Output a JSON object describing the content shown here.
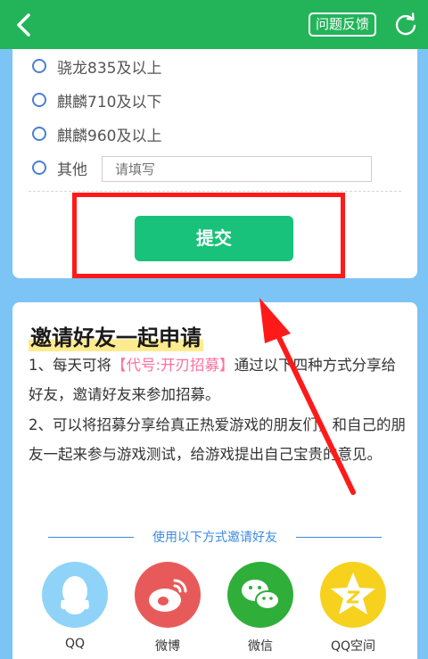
{
  "header": {
    "feedback_label": "问题反馈",
    "colors": {
      "bar": "#23b45a"
    }
  },
  "form": {
    "options": [
      {
        "label": "骁龙835及以上"
      },
      {
        "label": "麒麟710及以下"
      },
      {
        "label": "麒麟960及以上"
      },
      {
        "label": "其他"
      }
    ],
    "other_placeholder": "请填写",
    "submit_label": "提交"
  },
  "invite": {
    "title": "邀请好友一起申请",
    "p1_before": "1、每天可将",
    "p1_highlight": "【代号:开刃招募】",
    "p1_after": "通过以下四种方式分享给好友，邀请好友来参加招募。",
    "p2": "2、可以将招募分享给真正热爱游戏的朋友们，和自己的朋友一起来参与游戏测试，给游戏提出自己宝贵的意见。",
    "share_title": "使用以下方式邀请好友",
    "share": [
      {
        "label": "QQ",
        "icon": "qq-icon",
        "color": "#8fd3f8"
      },
      {
        "label": "微博",
        "icon": "weibo-icon",
        "color": "#e85a5a"
      },
      {
        "label": "微信",
        "icon": "wechat-icon",
        "color": "#2fae3a"
      },
      {
        "label": "QQ空间",
        "icon": "qzone-icon",
        "color": "#f6d11e"
      }
    ]
  }
}
